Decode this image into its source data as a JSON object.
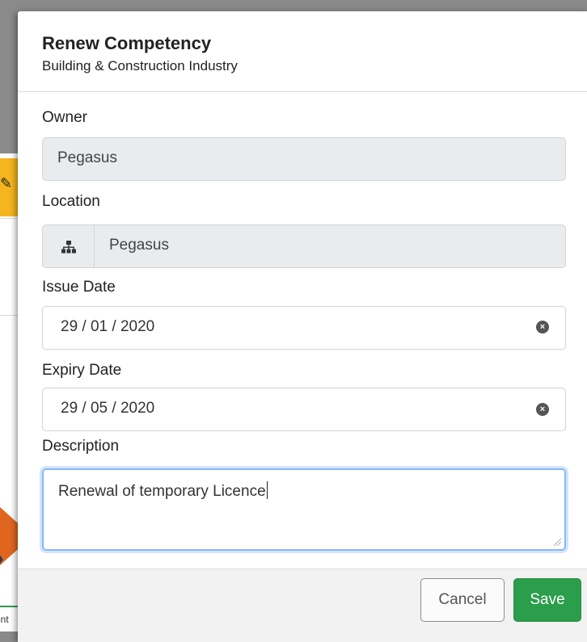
{
  "background": {
    "tab_fragment": "ent"
  },
  "modal": {
    "title": "Renew Competency",
    "subtitle": "Building & Construction Industry",
    "owner": {
      "label": "Owner",
      "value": "Pegasus"
    },
    "location": {
      "label": "Location",
      "value": "Pegasus",
      "icon": "sitemap-icon"
    },
    "issue_date": {
      "label": "Issue Date",
      "value": "29 / 01 / 2020"
    },
    "expiry_date": {
      "label": "Expiry Date",
      "value": "29 / 05 / 2020"
    },
    "description": {
      "label": "Description",
      "value": "Renewal of temporary Licence"
    },
    "buttons": {
      "cancel": "Cancel",
      "save": "Save"
    }
  },
  "colors": {
    "save_button": "#2a9e4a",
    "focus_border": "#86b7fe",
    "readonly_bg": "#e9ecef",
    "accent_arrow": "#e06620",
    "accent_yellow": "#f4b51f"
  }
}
